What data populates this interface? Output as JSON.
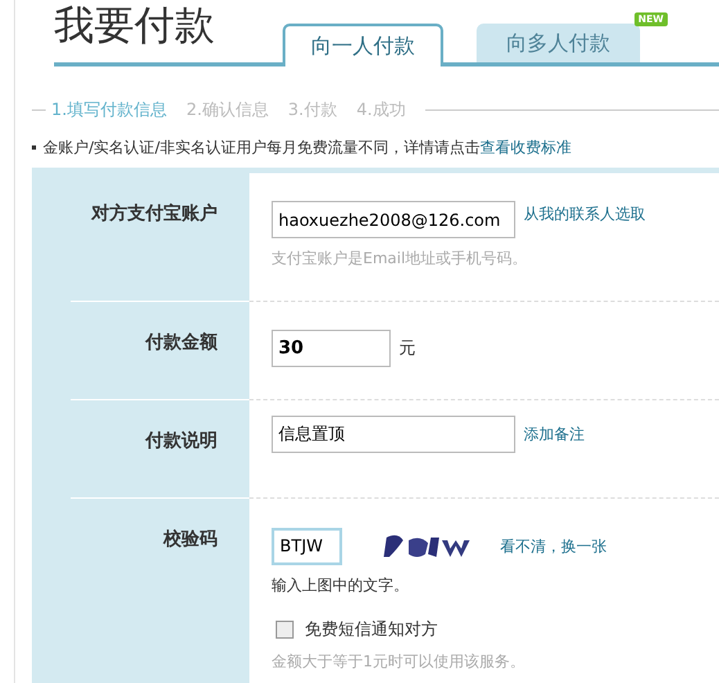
{
  "title": "我要付款",
  "tabs": [
    {
      "label": "向一人付款",
      "selected": true
    },
    {
      "label": "向多人付款",
      "selected": false,
      "badge": "NEW"
    }
  ],
  "steps": [
    {
      "label": "1.填写付款信息",
      "selected": true
    },
    {
      "label": "2.确认信息",
      "selected": false
    },
    {
      "label": "3.付款",
      "selected": false
    },
    {
      "label": "4.成功",
      "selected": false
    }
  ],
  "notice": {
    "text": "金账户/实名认证/非实名认证用户每月免费流量不同，详情请点击",
    "link": "查看收费标准"
  },
  "form": [
    {
      "kind": "account",
      "label": "对方支付宝账户",
      "value": "haoxuezhe2008@126.com",
      "link": "从我的联系人选取",
      "hint": "支付宝账户是Email地址或手机号码。"
    },
    {
      "kind": "amount",
      "label": "付款金额",
      "value": "30",
      "unit": "元"
    },
    {
      "kind": "note",
      "label": "付款说明",
      "value": "信息置顶",
      "link": "添加备注"
    },
    {
      "kind": "captcha",
      "label": "校验码",
      "value": "BTJW",
      "link": "看不清，换一张",
      "hint": "输入上图中的文字。",
      "sms": {
        "label": "免费短信通知对方",
        "checked": false,
        "hint": "金额大于等于1元时可以使用该服务。"
      }
    }
  ]
}
